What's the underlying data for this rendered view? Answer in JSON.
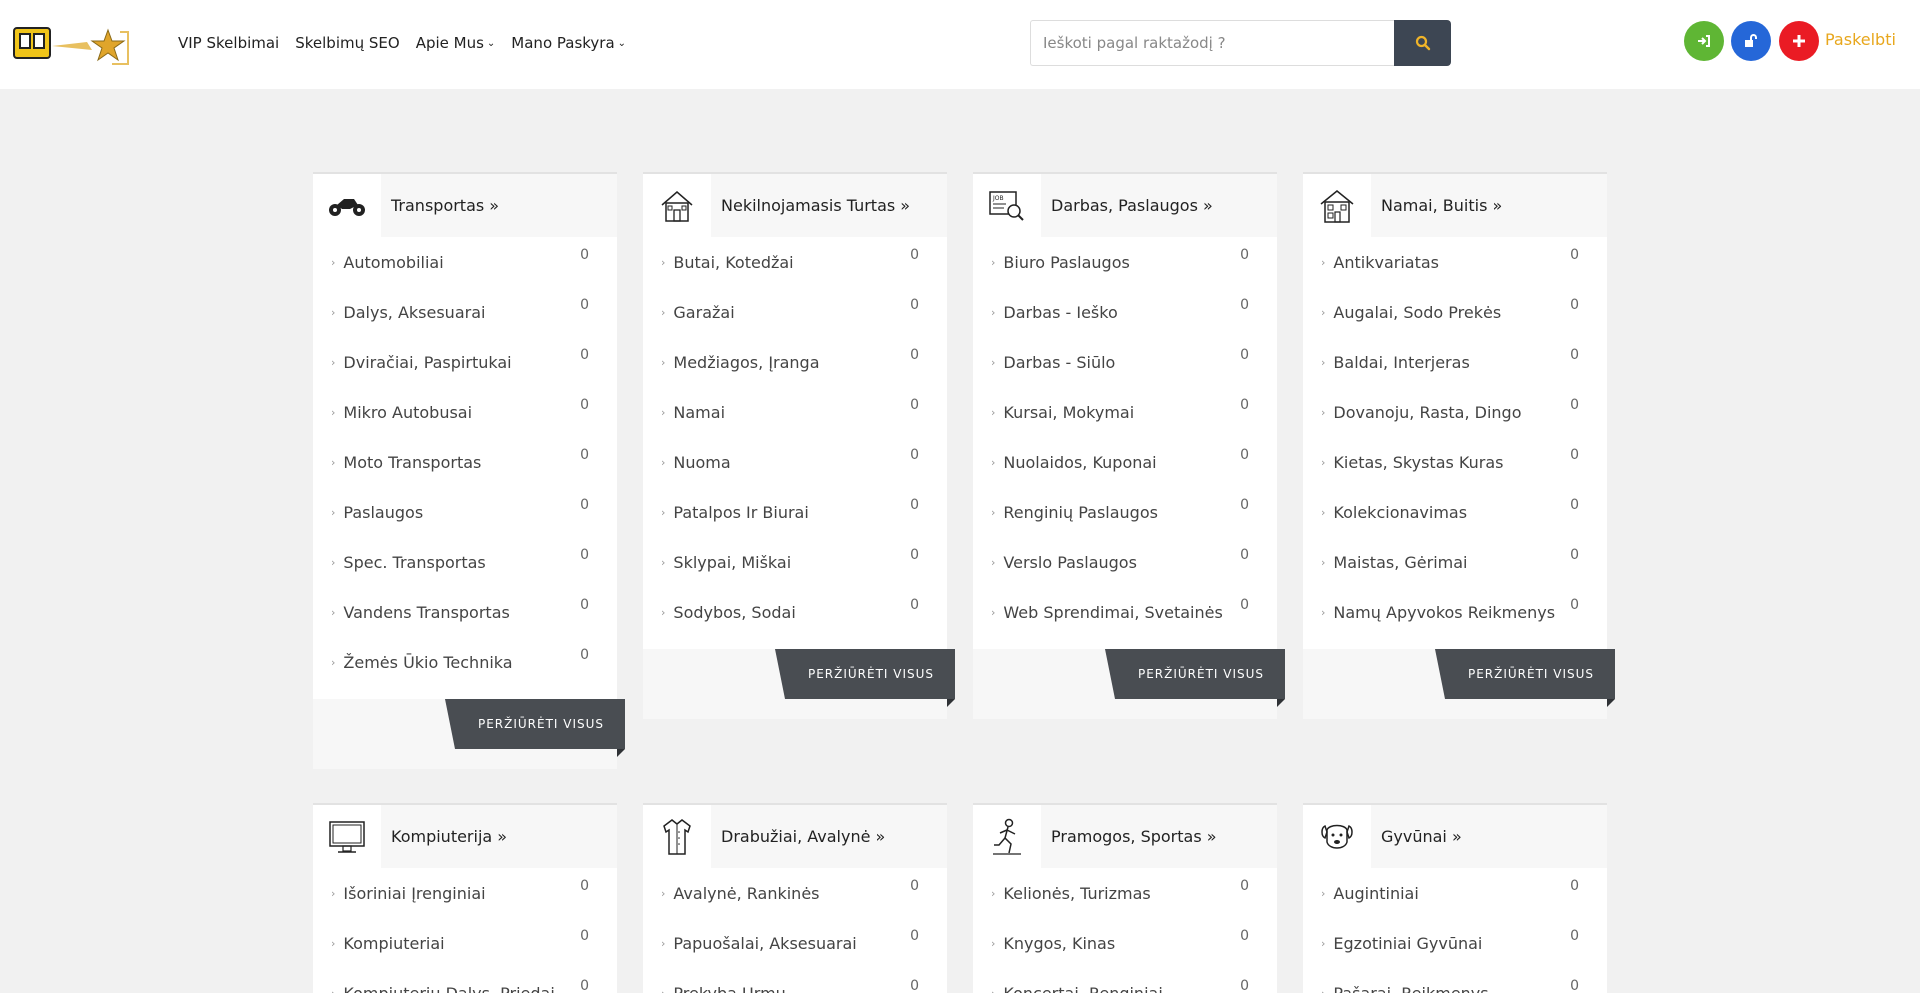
{
  "nav": {
    "items": [
      {
        "label": "VIP Skelbimai",
        "dropdown": false
      },
      {
        "label": "Skelbimų SEO",
        "dropdown": false
      },
      {
        "label": "Apie Mus",
        "dropdown": true
      },
      {
        "label": "Mano Paskyra",
        "dropdown": true
      }
    ]
  },
  "search": {
    "placeholder": "Ieškoti pagal raktažodį ?"
  },
  "actions": {
    "post_label": "Paskelbti"
  },
  "view_all_label": "PERŽIŪRĖTI VISUS",
  "colors": {
    "login": "#5fb634",
    "register": "#2567d8",
    "post": "#ea1b24",
    "post_text": "#e8a71d",
    "search_btn": "#3d4653"
  },
  "categories": [
    {
      "title": "Transportas »",
      "icon": "motorcycle-icon",
      "items": [
        {
          "label": "Automobiliai",
          "count": "0"
        },
        {
          "label": "Dalys, Aksesuarai",
          "count": "0"
        },
        {
          "label": "Dviračiai, Paspirtukai",
          "count": "0"
        },
        {
          "label": "Mikro Autobusai",
          "count": "0"
        },
        {
          "label": "Moto Transportas",
          "count": "0"
        },
        {
          "label": "Paslaugos",
          "count": "0"
        },
        {
          "label": "Spec. Transportas",
          "count": "0"
        },
        {
          "label": "Vandens Transportas",
          "count": "0"
        },
        {
          "label": "Žemės Ūkio Technika",
          "count": "0"
        }
      ]
    },
    {
      "title": "Nekilnojamasis Turtas »",
      "icon": "house-icon",
      "items": [
        {
          "label": "Butai, Kotedžai",
          "count": "0"
        },
        {
          "label": "Garažai",
          "count": "0"
        },
        {
          "label": "Medžiagos, Įranga",
          "count": "0"
        },
        {
          "label": "Namai",
          "count": "0"
        },
        {
          "label": "Nuoma",
          "count": "0"
        },
        {
          "label": "Patalpos Ir Biurai",
          "count": "0"
        },
        {
          "label": "Sklypai, Miškai",
          "count": "0"
        },
        {
          "label": "Sodybos, Sodai",
          "count": "0"
        }
      ]
    },
    {
      "title": "Darbas, Paslaugos »",
      "icon": "job-search-icon",
      "items": [
        {
          "label": "Biuro Paslaugos",
          "count": "0"
        },
        {
          "label": "Darbas - Ieško",
          "count": "0"
        },
        {
          "label": "Darbas - Siūlo",
          "count": "0"
        },
        {
          "label": "Kursai, Mokymai",
          "count": "0"
        },
        {
          "label": "Nuolaidos, Kuponai",
          "count": "0"
        },
        {
          "label": "Renginių Paslaugos",
          "count": "0"
        },
        {
          "label": "Verslo Paslaugos",
          "count": "0"
        },
        {
          "label": "Web Sprendimai, Svetainės",
          "count": "0"
        }
      ]
    },
    {
      "title": "Namai, Buitis »",
      "icon": "home-building-icon",
      "items": [
        {
          "label": "Antikvariatas",
          "count": "0"
        },
        {
          "label": "Augalai, Sodo Prekės",
          "count": "0"
        },
        {
          "label": "Baldai, Interjeras",
          "count": "0"
        },
        {
          "label": "Dovanoju, Rasta, Dingo",
          "count": "0"
        },
        {
          "label": "Kietas, Skystas Kuras",
          "count": "0"
        },
        {
          "label": "Kolekcionavimas",
          "count": "0"
        },
        {
          "label": "Maistas, Gėrimai",
          "count": "0"
        },
        {
          "label": "Namų Apyvokos Reikmenys",
          "count": "0"
        }
      ]
    },
    {
      "title": "Kompiuterija »",
      "icon": "monitor-icon",
      "items": [
        {
          "label": "Išoriniai Įrenginiai",
          "count": "0"
        },
        {
          "label": "Kompiuteriai",
          "count": "0"
        },
        {
          "label": "Kompiuterių Dalys, Priedai",
          "count": "0"
        }
      ]
    },
    {
      "title": "Drabužiai, Avalynė »",
      "icon": "shirt-icon",
      "items": [
        {
          "label": "Avalynė, Rankinės",
          "count": "0"
        },
        {
          "label": "Papuošalai, Aksesuarai",
          "count": "0"
        },
        {
          "label": "Prekyba Urmu",
          "count": "0"
        }
      ]
    },
    {
      "title": "Pramogos, Sportas »",
      "icon": "sport-icon",
      "items": [
        {
          "label": "Kelionės, Turizmas",
          "count": "0"
        },
        {
          "label": "Knygos, Kinas",
          "count": "0"
        },
        {
          "label": "Koncertai, Renginiai",
          "count": "0"
        }
      ]
    },
    {
      "title": "Gyvūnai »",
      "icon": "dog-icon",
      "items": [
        {
          "label": "Augintiniai",
          "count": "0"
        },
        {
          "label": "Egzotiniai Gyvūnai",
          "count": "0"
        },
        {
          "label": "Pašarai, Reikmenys",
          "count": "0"
        }
      ]
    }
  ]
}
